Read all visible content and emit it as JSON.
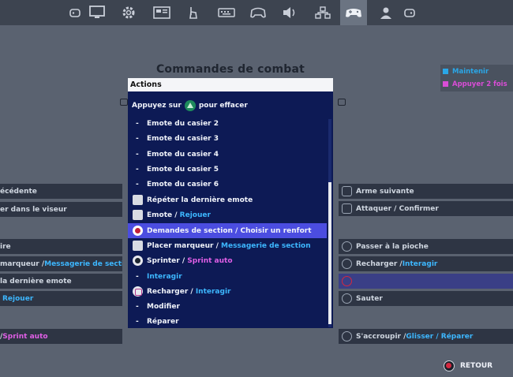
{
  "tabs": [
    {
      "icon": "gamepad-small-icon",
      "active": false
    },
    {
      "icon": "monitor-icon",
      "active": false
    },
    {
      "icon": "gear-icon",
      "active": false
    },
    {
      "icon": "display-icon",
      "active": false
    },
    {
      "icon": "touch-icon",
      "active": false
    },
    {
      "icon": "keyboard-icon",
      "active": false
    },
    {
      "icon": "controller-icon",
      "active": false
    },
    {
      "icon": "speaker-icon",
      "active": false
    },
    {
      "icon": "network-icon",
      "active": false
    },
    {
      "icon": "gamepad-icon",
      "active": true
    },
    {
      "icon": "account-icon",
      "active": false
    },
    {
      "icon": "gamepad-small-icon",
      "active": false
    }
  ],
  "page_title": "Commandes de combat",
  "legend": {
    "hold": {
      "label": "Maintenir",
      "color": "#2aa7e8"
    },
    "double": {
      "label": "Appuyer 2 fois",
      "color": "#d94dd6"
    }
  },
  "left_rows": [
    {
      "text": "écédente"
    },
    {
      "text": "er dans le viseur"
    },
    {
      "text": "ire"
    },
    {
      "text": "marqueur / ",
      "accent": "Messagerie de section"
    },
    {
      "text": "la dernière emote"
    },
    {
      "text": "Rejouer"
    },
    {
      "text": "/ ",
      "accent": "Sprint auto"
    }
  ],
  "right_rows": [
    {
      "text": "Arme suivante"
    },
    {
      "text": "Attaquer / Confirmer"
    },
    {
      "text": "Passer à la pioche"
    },
    {
      "text": "Recharger / ",
      "accent": "Interagir"
    },
    {
      "text": ""
    },
    {
      "text": "Sauter"
    },
    {
      "text": "S'accroupir / ",
      "accent": "Glisser / Réparer"
    }
  ],
  "dropdown": {
    "header": "Actions",
    "hint_before": "Appuyez sur",
    "hint_after": "pour effacer",
    "items": [
      {
        "main": "Emote du casier 2",
        "icon": "dash"
      },
      {
        "main": "Emote du casier 3",
        "icon": "dash"
      },
      {
        "main": "Emote du casier 4",
        "icon": "dash"
      },
      {
        "main": "Emote du casier 5",
        "icon": "dash"
      },
      {
        "main": "Emote du casier 6",
        "icon": "dash"
      },
      {
        "main": "Répéter la dernière emote",
        "icon": "dpad-icon"
      },
      {
        "main": "Emote / ",
        "accent": "Rejouer",
        "icon": "dpad-icon"
      },
      {
        "main": "Demandes de section / Choisir un renfort",
        "icon": "circle-button-icon",
        "selected": true
      },
      {
        "main": "Placer marqueur / ",
        "accent": "Messagerie de section",
        "icon": "dpad-icon"
      },
      {
        "main": "Sprinter / ",
        "accent_pink": "Sprint auto",
        "icon": "stick-icon"
      },
      {
        "main": "",
        "accent": "Interagir",
        "icon": "dash"
      },
      {
        "main": "Recharger / ",
        "accent": "Interagir",
        "icon": "square-button-icon"
      },
      {
        "main": "Modifier",
        "icon": "dash"
      },
      {
        "main": "Réparer",
        "icon": "dash"
      }
    ]
  },
  "back_label": "RETOUR"
}
